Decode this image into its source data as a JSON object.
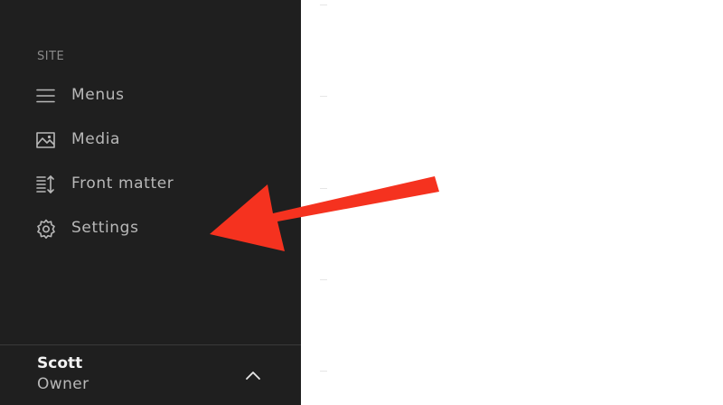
{
  "sidebar": {
    "section_label": "SITE",
    "items": [
      {
        "label": "Menus",
        "icon": "hamburger-menu-icon"
      },
      {
        "label": "Media",
        "icon": "image-icon"
      },
      {
        "label": "Front matter",
        "icon": "front-matter-icon"
      },
      {
        "label": "Settings",
        "icon": "gear-icon"
      }
    ],
    "user": {
      "name": "Scott",
      "role": "Owner",
      "toggle_icon": "chevron-up-icon"
    }
  },
  "annotation": {
    "type": "arrow",
    "color": "#f5321f",
    "points_to": "Settings"
  },
  "colors": {
    "sidebar_bg": "#1f1f1f",
    "text_muted": "#b8b8b8",
    "text_bright": "#f2f2f2"
  }
}
